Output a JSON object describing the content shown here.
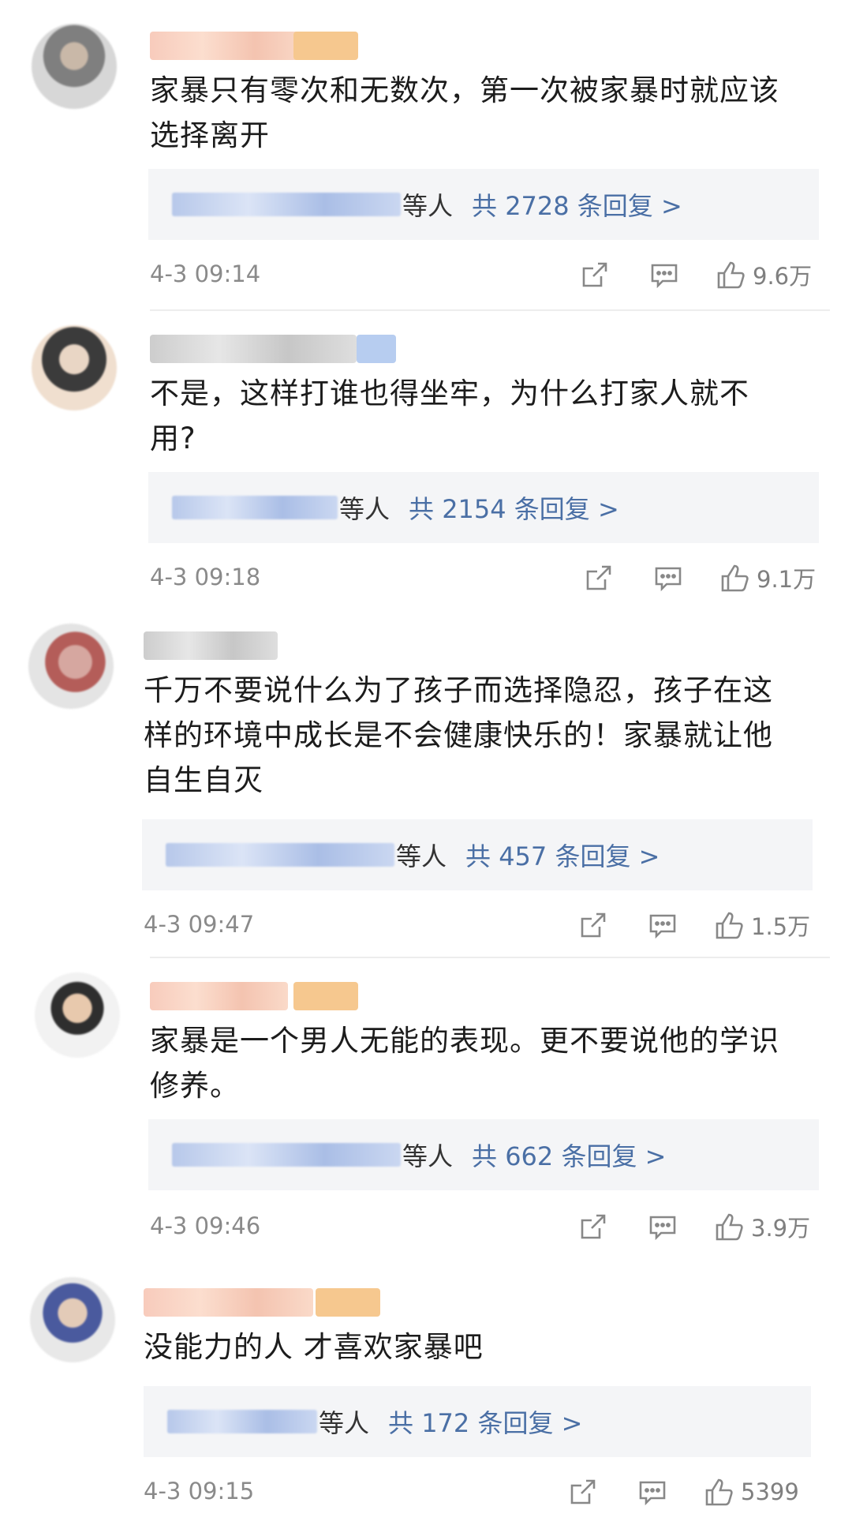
{
  "comments": [
    {
      "text_line1": "家暴只有零次和无数次，第一次被家暴时就应该",
      "text_line2": "选择离开",
      "text_line3": "",
      "reply_suffix": "等人",
      "reply_total": "共 2728 条回复 >",
      "time": "4-3 09:14",
      "likes": "9.6万"
    },
    {
      "text_line1": "不是，这样打谁也得坐牢，为什么打家人就不",
      "text_line2": "用?",
      "text_line3": "",
      "reply_suffix": "等人",
      "reply_total": "共 2154 条回复 >",
      "time": "4-3 09:18",
      "likes": "9.1万"
    },
    {
      "text_line1": "千万不要说什么为了孩子而选择隐忍，孩子在这",
      "text_line2": "样的环境中成长是不会健康快乐的！家暴就让他",
      "text_line3": "自生自灭",
      "reply_suffix": "等人",
      "reply_total": "共 457 条回复 >",
      "time": "4-3 09:47",
      "likes": "1.5万"
    },
    {
      "text_line1": "家暴是一个男人无能的表现。更不要说他的学识",
      "text_line2": "修养。",
      "text_line3": "",
      "reply_suffix": "等人",
      "reply_total": "共 662 条回复 >",
      "time": "4-3 09:46",
      "likes": "3.9万"
    },
    {
      "text_line1": "没能力的人 才喜欢家暴吧",
      "text_line2": "",
      "text_line3": "",
      "reply_suffix": "等人",
      "reply_total": "共 172 条回复 >",
      "time": "4-3 09:15",
      "likes": "5399"
    }
  ],
  "icons": {
    "share": "share-icon",
    "comment": "comment-icon",
    "like": "thumbs-up-icon"
  },
  "colors": {
    "link": "#4a6fa5",
    "muted": "#8a8a8a",
    "reply_bg": "#f4f5f7"
  }
}
